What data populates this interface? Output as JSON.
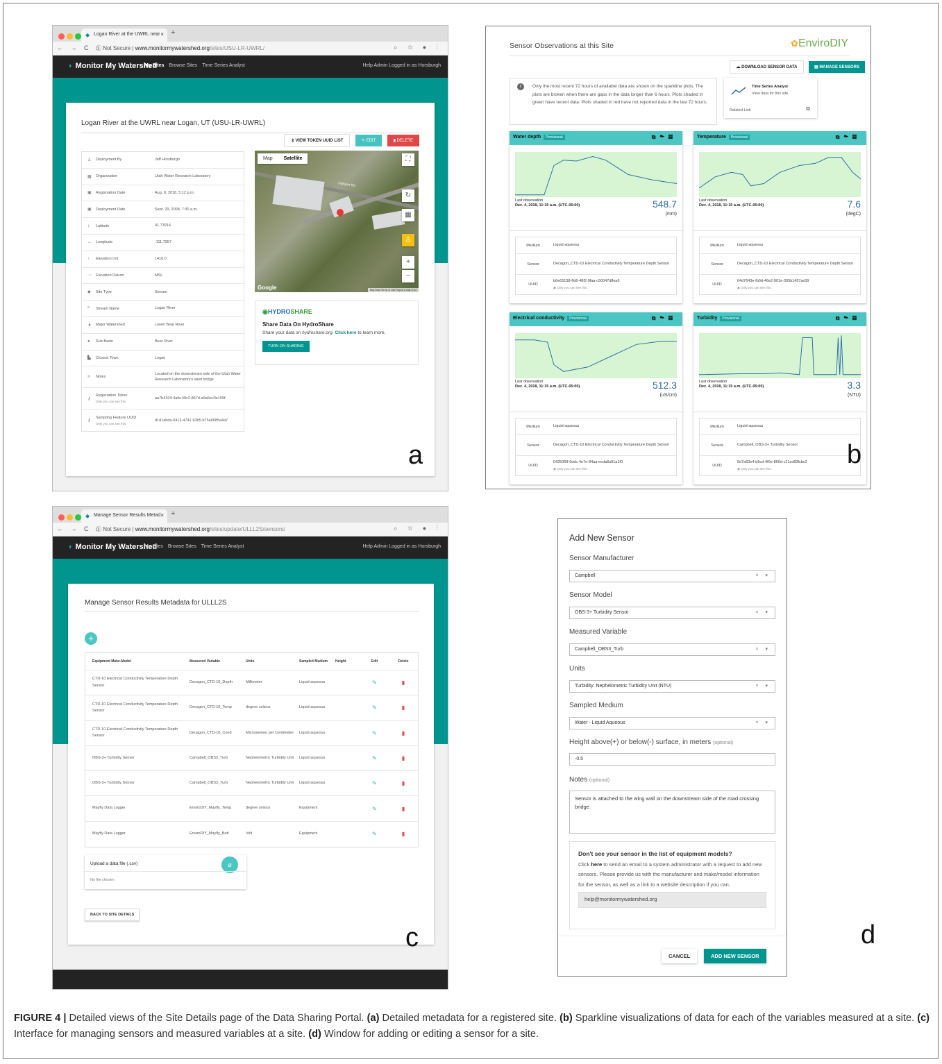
{
  "panelA": {
    "browser": {
      "tab_title": "Logan River at the UWRL near",
      "url_prefix": "Not Secure",
      "url_host": "www.monitormywatershed.org",
      "url_path": "/sites/USU-LR-UWRL/"
    },
    "app": {
      "brand": "Monitor My Watershed",
      "nav": [
        "My Sites",
        "Browse Sites",
        "Time Series Analyst"
      ],
      "right": "Help   Admin   Logged in as Horsburgh"
    },
    "site_title": "Logan River at the UWRL near Logan, UT (USU-LR-UWRL)",
    "buttons": {
      "view_token": "VIEW TOKEN UUID LIST",
      "edit": "EDIT",
      "delete": "DELETE"
    },
    "metadata": [
      {
        "icon": "person-icon",
        "glyph": "♙",
        "key": "Deployment By",
        "value": "Jeff Horsburgh"
      },
      {
        "icon": "building-icon",
        "glyph": "▦",
        "key": "Organization",
        "value": "Utah Water Research Laboratory"
      },
      {
        "icon": "calendar-icon",
        "glyph": "▣",
        "key": "Registration Date",
        "value": "Aug. 8, 2018, 5:12 p.m."
      },
      {
        "icon": "calendar-icon",
        "glyph": "▣",
        "key": "Deployment Date",
        "value": "Sept. 29, 2008, 7:30 a.m."
      },
      {
        "icon": "vertical-arrows-icon",
        "glyph": "↕",
        "key": "Latitude",
        "value": "41.73914"
      },
      {
        "icon": "horizontal-arrows-icon",
        "glyph": "↔",
        "key": "Longitude",
        "value": "-111.7957"
      },
      {
        "icon": "up-arrow-icon",
        "glyph": "↑",
        "key": "Elevation (m)",
        "value": "1416.0"
      },
      {
        "icon": "dots-icon",
        "glyph": "⋯",
        "key": "Elevation Datum",
        "value": "MSL"
      },
      {
        "icon": "flag-icon",
        "glyph": "◆",
        "key": "Site Type",
        "value": "Stream"
      },
      {
        "icon": "quote-icon",
        "glyph": "❞",
        "key": "Stream Name",
        "value": "Logan River"
      },
      {
        "icon": "mountain-icon",
        "glyph": "▲",
        "key": "Major Watershed",
        "value": "Lower Bear River"
      },
      {
        "icon": "circle-icon",
        "glyph": "●",
        "key": "Sub Basin",
        "value": "Bear River"
      },
      {
        "icon": "town-icon",
        "glyph": "▙",
        "key": "Closest Town",
        "value": "Logan"
      }
    ],
    "notes": {
      "key": "Notes",
      "value": "Located on the downstream side of the Utah Water Research Laboratory's west bridge"
    },
    "reg_token": {
      "key": "Registration Token",
      "sub": "Only you can see this.",
      "value": "aa7b4104-4afa-49c2-867d-a9a5ec0e109f"
    },
    "sampling_uuid": {
      "key": "Sampling Feature UUID",
      "sub": "Only you can see this.",
      "value": "d1d1abda-0413-4741-92b5-b75a0685a4a7"
    },
    "map": {
      "tab_map": "Map",
      "tab_sat": "Satellite",
      "road_label": "Canyon Rd",
      "google": "Google",
      "attribution": "Map Data  Terms of Use  Report a map error"
    },
    "hydroshare": {
      "logo_prefix": "HYDRO",
      "logo_suffix": "SHARE",
      "title": "Share Data On HydroShare",
      "text_before": "Share your data on ",
      "text_site": "hydroshare.org",
      "text_mid": ". ",
      "text_link": "Click here",
      "text_after": " to learn more.",
      "button": "TURN ON SHARING"
    },
    "letter": "a"
  },
  "panelB": {
    "title": "Sensor Observations at this Site",
    "logo": "EnviroDIY",
    "download": "DOWNLOAD SENSOR DATA",
    "manage": "MANAGE SENSORS",
    "info": "Only the most recent 72 hours of available data are shown on the sparkline plots. The plots are broken when there are gaps in the data longer than 6 hours. Plots shaded in green have recent data. Plots shaded in red have not reported data in the last 72 hours.",
    "tsa": {
      "title": "Time Series Analyst",
      "desc": "View data for this site.",
      "link": "Related Link"
    },
    "sensors": [
      {
        "name": "Water depth",
        "badge": "Provisional",
        "last_label": "Last observation",
        "last_time": "Dec. 4, 2018, 11:15 a.m. (UTC-05:00)",
        "value": "548.7",
        "unit": "(mm)",
        "medium_key": "Medium",
        "medium": "Liquid aqueous",
        "sensor_key": "Sensor",
        "sensor": "Decagon_CTD-10 Electrical Conductivity Temperature Depth Sensor",
        "uuid_key": "UUID",
        "uuid": "b6e65138-ffd6-48f2-9faa-c50047dffea9",
        "uuid_sub": "Only you can see this."
      },
      {
        "name": "Temperature",
        "badge": "Provisional",
        "last_label": "Last observation",
        "last_time": "Dec. 4, 2018, 11:15 a.m. (UTC-05:00)",
        "value": "7.6",
        "unit": "(degC)",
        "medium_key": "Medium",
        "medium": "Liquid aqueous",
        "sensor_key": "Sensor",
        "sensor": "Decagon_CTD-10 Electrical Conductivity Temperature Depth Sensor",
        "uuid_key": "UUID",
        "uuid": "64d7643e-fb0d-46e2-901e-305b1457ac69",
        "uuid_sub": "Only you can see this."
      },
      {
        "name": "Electrical conductivity",
        "badge": "Provisional",
        "last_label": "Last observation",
        "last_time": "Dec. 4, 2018, 11:15 a.m. (UTC-05:00)",
        "value": "512.3",
        "unit": "(uS/cm)",
        "medium_key": "Medium",
        "medium": "Liquid aqueous",
        "sensor_key": "Sensor",
        "sensor": "Decagon_CTD-10 Electrical Conductivity Temperature Depth Sensor",
        "uuid_key": "UUID",
        "uuid": "04250f5f-6ddc-4e7e-84aa-ecda8a91a1f0",
        "uuid_sub": "Only you can see this."
      },
      {
        "name": "Turbidity",
        "badge": "Provisional",
        "last_label": "Last observation",
        "last_time": "Dec. 4, 2018, 11:15 a.m. (UTC-05:00)",
        "value": "3.3",
        "unit": "(NTU)",
        "medium_key": "Medium",
        "medium": "Liquid aqueous",
        "sensor_key": "Sensor",
        "sensor": "Campbell_OBS-3+ Turbidity Sensor",
        "uuid_key": "UUID",
        "uuid": "9d7a63e4-b5cd-4f0e-860d-c21cd83fcbc2",
        "uuid_sub": "Only you can see this."
      }
    ],
    "letter": "b"
  },
  "panelC": {
    "browser": {
      "tab_title": "Manage Sensor Results Metad",
      "url_prefix": "Not Secure",
      "url_host": "www.monitormywatershed.org",
      "url_path": "/sites/update/ULLL2S/sensors/"
    },
    "app": {
      "brand": "Monitor My Watershed",
      "nav": [
        "My Sites",
        "Browse Sites",
        "Time Series Analyst"
      ],
      "right": "Help   Admin   Logged in as Horsburgh"
    },
    "title": "Manage Sensor Results Metadata for ULLL2S",
    "headers": [
      "Equipment Make-Model",
      "Measured Variable",
      "Units",
      "Sampled Medium",
      "Height",
      "Edit",
      "Delete"
    ],
    "rows": [
      {
        "model": "CTD-10 Electrical Conductivity Temperature Depth Sensor",
        "variable": "Decagon_CTD-10_Depth",
        "units": "Millimeter",
        "medium": "Liquid aqueous",
        "height": ""
      },
      {
        "model": "CTD-10 Electrical Conductivity Temperature Depth Sensor",
        "variable": "Decagon_CTD-10_Temp",
        "units": "degree celsius",
        "medium": "Liquid aqueous",
        "height": ""
      },
      {
        "model": "CTD-10 Electrical Conductivity Temperature Depth Sensor",
        "variable": "Decagon_CTD-10_Cond",
        "units": "Microsiemen per Centimeter",
        "medium": "Liquid aqueous",
        "height": ""
      },
      {
        "model": "OBS-3+ Turbidity Sensor",
        "variable": "Campbell_OBS3_Turb",
        "units": "Nephelometric Turbidity Unit",
        "medium": "Liquid aqueous",
        "height": ""
      },
      {
        "model": "OBS-3+ Turbidity Sensor",
        "variable": "Campbell_OBS3_Turb",
        "units": "Nephelometric Turbidity Unit",
        "medium": "Liquid aqueous",
        "height": ""
      },
      {
        "model": "Mayfly Data Logger",
        "variable": "EnviroDIY_Mayfly_Temp",
        "units": "degree celsius",
        "medium": "Equipment",
        "height": ""
      },
      {
        "model": "Mayfly Data Logger",
        "variable": "EnviroDIY_Mayfly_Batt",
        "units": "Volt",
        "medium": "Equipment",
        "height": ""
      }
    ],
    "upload_title": "Upload a data file (.csv)",
    "no_file": "No file chosen",
    "back": "BACK TO SITE DETAILS",
    "letter": "c"
  },
  "panelD": {
    "title": "Add New Sensor",
    "fields": [
      {
        "label": "Sensor Manufacturer",
        "value": "Campbell"
      },
      {
        "label": "Sensor Model",
        "value": "OBS-3+ Turbidity Sensor"
      },
      {
        "label": "Measured Variable",
        "value": "Campbell_OBS3_Turb"
      },
      {
        "label": "Units",
        "value": "Turbidity: Nephelometric Turbidity Unit (NTU)"
      },
      {
        "label": "Sampled Medium",
        "value": "Water - Liquid Aqueous"
      }
    ],
    "height_label": "Height above(+) or below(-) surface, in meters",
    "height_opt": "(optional)",
    "height_value": "-0.5",
    "notes_label": "Notes",
    "notes_opt": "(optional)",
    "notes_value": "Sensor is attached to the wing wall on the downstream side of the road crossing bridge.",
    "help_title": "Don't see your sensor in the list of equipment models?",
    "help_pre": "Click ",
    "help_link": "here",
    "help_post": " to send an email to a system administrator with a request to add new sensors. Please provide us with the manufacturer and make/model information for the sensor, as well as a link to a website description if you can.",
    "help_email": "help@monitormywatershed.org",
    "cancel": "CANCEL",
    "add": "ADD NEW SENSOR",
    "letter": "d"
  },
  "caption": {
    "label": "FIGURE 4 |",
    "intro": " Detailed views of the Site Details page of the Data Sharing Portal. ",
    "a_tag": "(a)",
    "a_text": " Detailed metadata for a registered site. ",
    "b_tag": "(b)",
    "b_text": " Sparkline visualizations of data for each of the variables measured at a site. ",
    "c_tag": "(c)",
    "c_text": " Interface for managing sensors and measured variables at a site. ",
    "d_tag": "(d)",
    "d_text": " Window for adding or editing a sensor for a site."
  },
  "colors": {
    "teal": "#00968f",
    "teal_light": "#4cc6c3",
    "red": "#e04747",
    "spark_bg": "#d8f5d3",
    "spark_line": "#2f6ea8"
  }
}
